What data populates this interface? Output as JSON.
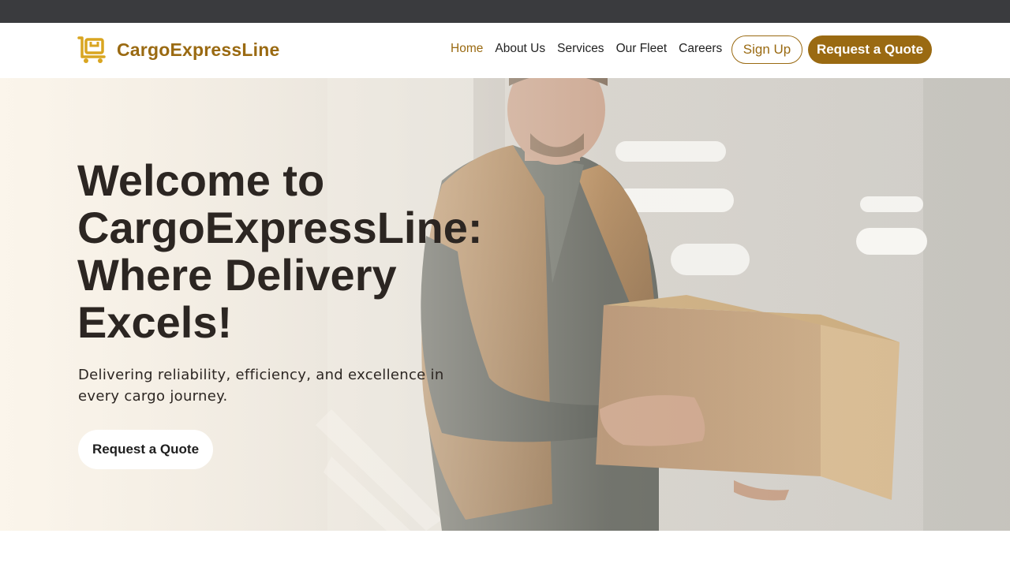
{
  "brand": {
    "name": "CargoExpressLine",
    "icon": "cart-box-icon",
    "color": "#9a6a12"
  },
  "nav": {
    "links": [
      {
        "label": "Home",
        "active": true
      },
      {
        "label": "About Us",
        "active": false
      },
      {
        "label": "Services",
        "active": false
      },
      {
        "label": "Our Fleet",
        "active": false
      },
      {
        "label": "Careers",
        "active": false
      }
    ],
    "signup_label": "Sign Up",
    "quote_label": "Request a Quote"
  },
  "hero": {
    "title": "Welcome to CargoExpressLine: Where Delivery Excels!",
    "subtitle": "Delivering reliability, efficiency, and excellence in every cargo journey.",
    "cta_label": "Request a Quote",
    "image": "delivery-man-holding-box"
  },
  "colors": {
    "accent": "#9a6a12",
    "topbar": "#3a3b3e",
    "heading": "#2c2622"
  }
}
